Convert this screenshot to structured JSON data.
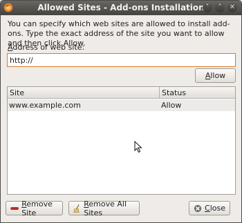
{
  "window": {
    "title": "Allowed Sites - Add-ons Installation",
    "title_buttons": [
      "˅",
      "˄",
      "✕"
    ]
  },
  "description": "You can specify which web sites are allowed to install add-ons. Type the exact address of the site you want to allow and then click Allow.",
  "address": {
    "label_mnemonic": "A",
    "label_rest": "ddress of web site:",
    "value": "http://"
  },
  "buttons": {
    "allow_mnemonic": "A",
    "allow_rest": "llow",
    "remove_mnemonic": "R",
    "remove_rest": "emove Site",
    "remove_all_mnemonic": "R",
    "remove_all_rest": "emove All Sites",
    "close_mnemonic": "C",
    "close_rest": "lose"
  },
  "list": {
    "columns": [
      "Site",
      "Status"
    ],
    "rows": [
      {
        "site": "www.example.com",
        "status": "Allow"
      }
    ]
  },
  "colors": {
    "titlebar": "#45433e",
    "input_focus": "#d57b2c",
    "selected_row": "#ecebe9"
  }
}
